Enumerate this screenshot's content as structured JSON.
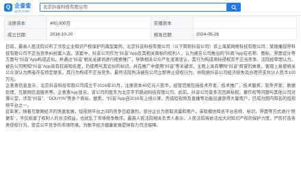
{
  "header": {
    "logo_text": "企查查",
    "logo_sub": "QCC.COM",
    "search_value": "北京抖音科技有限公司"
  },
  "info_table": {
    "row1": {
      "k1": "注册资本",
      "v1": "400,000万",
      "k2": "实缴资本",
      "v2": ""
    },
    "row2": {
      "k1": "成立日期",
      "v1": "2016-10-20",
      "k2": "核准日期",
      "v2": "2024-05-26"
    }
  },
  "article": {
    "p1": "日前，最高人民法院公布了涉及企业知识产权保护的典型案例，北京抖音科技有限公司（以下简称抖音公司）诉上海某网络科技有限公司、某微播视界科技有限公司不正当竞争纠纷案入选。该案中，抖音公司作为“抖音”App及其相关商标的权利人，认为被告公司推出的“抖商”App在名称、图标、界面设计等方面与“抖音”App构成近似，并通过“抖音”相关关键词进行搜索推广，导致相关公众产生混淆误认，其行为构成商标侵权及不正当竞争。法院经审理认为，被告公司明知“抖音”App具有较高知名度，仍使用与其近似的标识，并在推广中使用“抖音”等关键词，主观上具有攀附“抖音”商誉的故意，客观上易使相关公众误认为两者存在特定联系，其行为构成不正当竞争。最终法院判决被告公司立即停止侵权行为，并赔偿抖音公司经济损失及合理开支共计人民币100万元。",
    "p2": "企查查信息显示，北京抖音科技有限公司成立于2016年10月，注册资本40亿元人民币，经营范围包括技术开发、技术推广、技术服务、软件开发、数据处理、互联网信息服务等。企查查App显示，该公司的股东为北京字节跳动科技有限公司。此前，抖音公司曾多次因商标权、著作权等问题与其他公司对簿公堂，涉及“抖音”、“DOUYIN”等多个商标。据悉，“抖音”App自2016年上线以来，凭借短视频及直播等功能迅速获得大量用户，已成为国内知名的短视频平台之一。",
    "p3": "近年来，随着互联网经济的快速发展，短视频平台之间的竞争日趋激烈，部分企业为获取流量和用户，采取模仿知名平台名称、标识、界面等方式进行“搭便车”，不仅损害了权利人的合法权益，也扰乱了市场竞争秩序。最高人民法院相关负责人表示，人民法院将依法加大对知识产权的保护力度，严厉打击各类侵权行为，营造公平竞争的市场环境，为数字经济健康发展提供有力司法保障。"
  }
}
